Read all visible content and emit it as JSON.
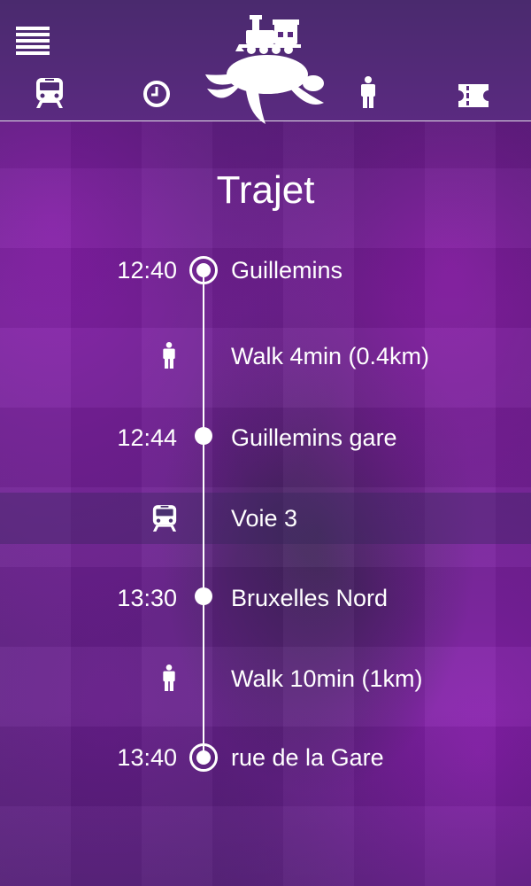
{
  "header": {
    "menu_icon": "menu-icon",
    "nav": [
      {
        "name": "train-icon"
      },
      {
        "name": "clock-icon"
      },
      {
        "name": "person-icon"
      },
      {
        "name": "ticket-icon"
      }
    ],
    "logo": "turtle-train-logo"
  },
  "page": {
    "title": "Trajet"
  },
  "itinerary": [
    {
      "type": "stop",
      "time": "12:40",
      "label": "Guillemins",
      "marker": "ring"
    },
    {
      "type": "walk",
      "icon": "person-icon",
      "label": "Walk 4min (0.4km)"
    },
    {
      "type": "stop",
      "time": "12:44",
      "label": "Guillemins gare",
      "marker": "dot"
    },
    {
      "type": "train",
      "icon": "train-icon",
      "label": "Voie 3"
    },
    {
      "type": "stop",
      "time": "13:30",
      "label": "Bruxelles Nord",
      "marker": "dot"
    },
    {
      "type": "walk",
      "icon": "person-icon",
      "label": "Walk 10min (1km)"
    },
    {
      "type": "stop",
      "time": "13:40",
      "label": "rue de la Gare",
      "marker": "ring"
    }
  ],
  "colors": {
    "background": "#5c2480",
    "header": "#4a2a6e",
    "text": "#ffffff"
  }
}
